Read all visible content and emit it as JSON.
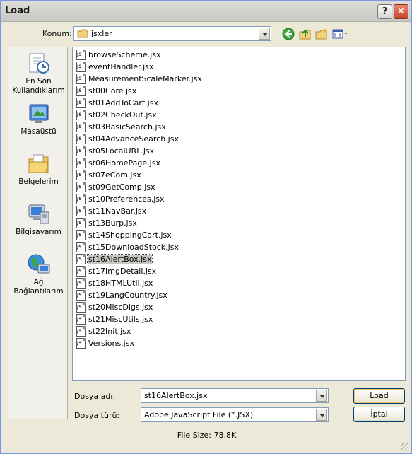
{
  "window": {
    "title": "Load",
    "help_label": "?",
    "close_label": "✕"
  },
  "toolbar": {
    "look_in_label": "Konum:",
    "look_in_value": "jsxler",
    "icons": [
      "back-icon",
      "up-folder-icon",
      "new-folder-icon",
      "view-menu-icon"
    ]
  },
  "places": [
    {
      "label": "En Son Kullandıklarım",
      "icon": "recent-documents-icon"
    },
    {
      "label": "Masaüstü",
      "icon": "desktop-icon"
    },
    {
      "label": "Belgelerim",
      "icon": "my-documents-icon"
    },
    {
      "label": "Bilgisayarım",
      "icon": "my-computer-icon"
    },
    {
      "label": "Ağ Bağlantılarım",
      "icon": "network-places-icon"
    }
  ],
  "files": [
    "browseScheme.jsx",
    "eventHandler.jsx",
    "MeasurementScaleMarker.jsx",
    "st00Core.jsx",
    "st01AddToCart.jsx",
    "st02CheckOut.jsx",
    "st03BasicSearch.jsx",
    "st04AdvanceSearch.jsx",
    "st05LocalURL.jsx",
    "st06HomePage.jsx",
    "st07eCom.jsx",
    "st09GetComp.jsx",
    "st10Preferences.jsx",
    "st11NavBar.jsx",
    "st13Burp.jsx",
    "st14ShoppingCart.jsx",
    "st15DownloadStock.jsx",
    "st16AlertBox.jsx",
    "st17ImgDetail.jsx",
    "st18HTMLUtil.jsx",
    "st19LangCountry.jsx",
    "st20MiscDlgs.jsx",
    "st21MiscUtils.jsx",
    "st22Init.jsx",
    "Versions.jsx"
  ],
  "selected_file_index": 17,
  "file_name": {
    "label": "Dosya adı:",
    "value": "st16AlertBox.jsx"
  },
  "file_type": {
    "label": "Dosya türü:",
    "value": "Adobe JavaScript File (*.JSX)"
  },
  "buttons": {
    "load": "Load",
    "cancel": "İptal"
  },
  "status": {
    "file_size": "File Size: 78,8K"
  }
}
